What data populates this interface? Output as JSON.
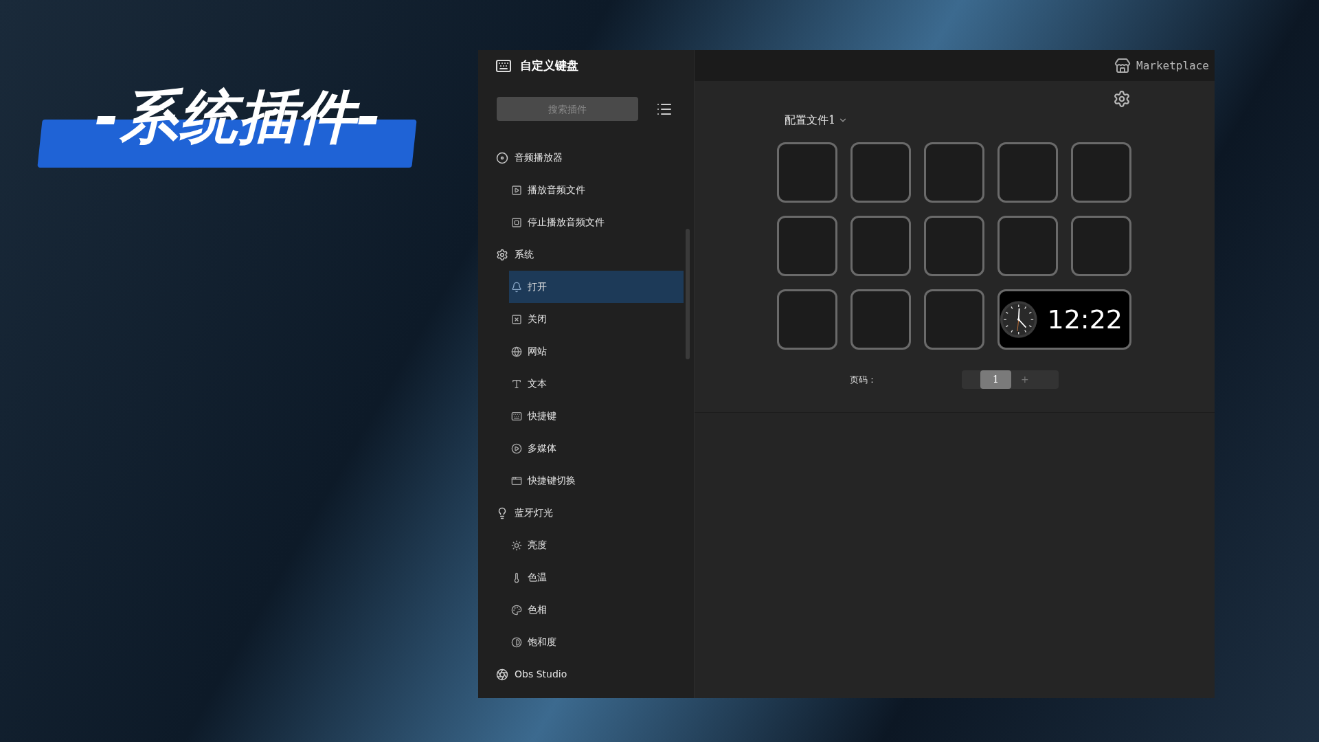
{
  "banner": {
    "title": "-系统插件-"
  },
  "app": {
    "title": "自定义键盘",
    "search": {
      "placeholder": "搜索插件"
    },
    "plugins": [
      {
        "label": "音频播放器",
        "children": [
          {
            "label": "播放音频文件",
            "selected": false
          },
          {
            "label": "停止播放音频文件",
            "selected": false
          }
        ]
      },
      {
        "label": "系统",
        "children": [
          {
            "label": "打开",
            "selected": true
          },
          {
            "label": "关闭",
            "selected": false
          },
          {
            "label": "网站",
            "selected": false
          },
          {
            "label": "文本",
            "selected": false
          },
          {
            "label": "快捷键",
            "selected": false
          },
          {
            "label": "多媒体",
            "selected": false
          },
          {
            "label": "快捷键切换",
            "selected": false
          }
        ]
      },
      {
        "label": "蓝牙灯光",
        "children": [
          {
            "label": "亮度",
            "selected": false
          },
          {
            "label": "色温",
            "selected": false
          },
          {
            "label": "色相",
            "selected": false
          },
          {
            "label": "饱和度",
            "selected": false
          }
        ]
      },
      {
        "label": "Obs Studio"
      }
    ]
  },
  "marketplace": "Marketplace",
  "profile": "配置文件1",
  "keys": [
    {
      "kind": "empty"
    },
    {
      "kind": "empty"
    },
    {
      "kind": "empty"
    },
    {
      "kind": "empty"
    },
    {
      "kind": "empty"
    },
    {
      "kind": "empty"
    },
    {
      "kind": "empty"
    },
    {
      "kind": "empty"
    },
    {
      "kind": "empty"
    },
    {
      "kind": "empty"
    },
    {
      "kind": "empty"
    },
    {
      "kind": "empty"
    },
    {
      "kind": "empty"
    },
    {
      "kind": "clock",
      "time": "12:22"
    }
  ],
  "pager": {
    "label": "页码：",
    "pages": [
      {
        "label": "1",
        "selected": true
      }
    ],
    "add": "+"
  }
}
